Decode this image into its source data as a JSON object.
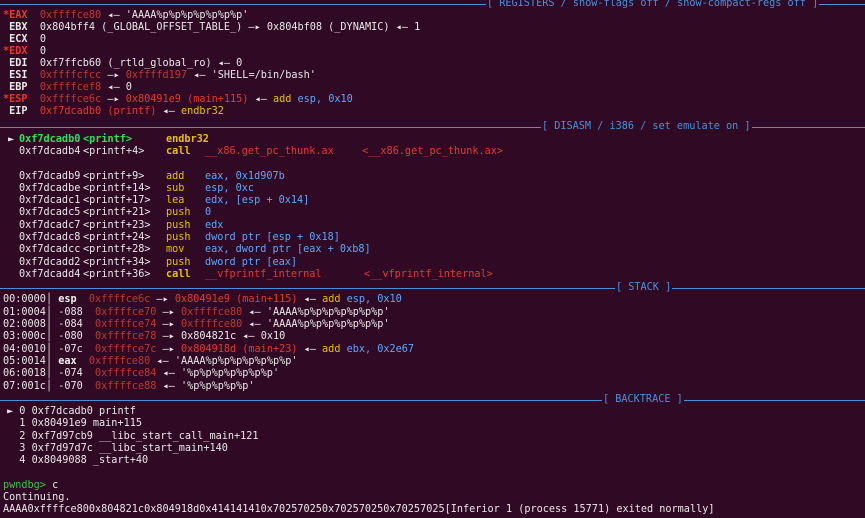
{
  "sections": {
    "registers": "[ REGISTERS / show-flags off / show-compact-regs off ]",
    "disasm": "[ DISASM / i386 / set emulate on ]",
    "stack": "[ STACK ]",
    "backtrace": "[ BACKTRACE ]"
  },
  "registers": {
    "eax": {
      "name": "*EAX",
      "addr": "0xffffce80",
      "arrow": "◂—",
      "str": "'AAAA%p%p%p%p%p%p%p'"
    },
    "ebx": {
      "name": " EBX",
      "addr": "0x804bff4",
      "sym": "(_GLOBAL_OFFSET_TABLE_)",
      "arrow": "—▸",
      "addr2": "0x804bf08",
      "sym2": "(_DYNAMIC)",
      "arrow2": "◂—",
      "val": "1"
    },
    "ecx": {
      "name": " ECX",
      "val": "0"
    },
    "edx": {
      "name": "*EDX",
      "val": "0"
    },
    "edi": {
      "name": " EDI",
      "addr": "0xf7ffcb60",
      "sym": "(_rtld_global_ro)",
      "arrow": "◂—",
      "val": "0"
    },
    "esi": {
      "name": " ESI",
      "addr": "0xffffcfcc",
      "arrow": "—▸",
      "addr2": "0xffffd197",
      "arrow2": "◂—",
      "str": "'SHELL=/bin/bash'"
    },
    "ebp": {
      "name": " EBP",
      "addr": "0xffffcef8",
      "arrow": "◂—",
      "val": "0"
    },
    "esp": {
      "name": "*ESP",
      "addr": "0xffffce6c",
      "arrow": "—▸",
      "addr2": "0x80491e9",
      "sym2": "(main+115)",
      "arrow2": "◂—",
      "ins": "add",
      "ops": "esp, 0x10"
    },
    "eip": {
      "name": " EIP",
      "addr": "0xf7dcadb0",
      "sym": "(printf)",
      "arrow": "◂—",
      "ins": "endbr32"
    }
  },
  "disasm": [
    {
      "cur": "►",
      "addr": "0xf7dcadb0",
      "sym": "<printf>",
      "ins": "endbr32",
      "ops": "",
      "tgt": ""
    },
    {
      "cur": "",
      "addr": "0xf7dcadb4",
      "sym": "<printf+4>",
      "ins": "call",
      "ops": "__x86.get_pc_thunk.ax",
      "tgt": "<__x86.get_pc_thunk.ax>"
    },
    {
      "cur": "",
      "addr": "0xf7dcadb9",
      "sym": "<printf+9>",
      "ins": "add",
      "ops": "eax, 0x1d907b",
      "tgt": ""
    },
    {
      "cur": "",
      "addr": "0xf7dcadbe",
      "sym": "<printf+14>",
      "ins": "sub",
      "ops": "esp, 0xc",
      "tgt": ""
    },
    {
      "cur": "",
      "addr": "0xf7dcadc1",
      "sym": "<printf+17>",
      "ins": "lea",
      "ops": "edx, [esp + 0x14]",
      "tgt": ""
    },
    {
      "cur": "",
      "addr": "0xf7dcadc5",
      "sym": "<printf+21>",
      "ins": "push",
      "ops": "0",
      "tgt": ""
    },
    {
      "cur": "",
      "addr": "0xf7dcadc7",
      "sym": "<printf+23>",
      "ins": "push",
      "ops": "edx",
      "tgt": ""
    },
    {
      "cur": "",
      "addr": "0xf7dcadc8",
      "sym": "<printf+24>",
      "ins": "push",
      "ops": "dword ptr [esp + 0x18]",
      "tgt": ""
    },
    {
      "cur": "",
      "addr": "0xf7dcadcc",
      "sym": "<printf+28>",
      "ins": "mov",
      "ops": "eax, dword ptr [eax + 0xb8]",
      "tgt": ""
    },
    {
      "cur": "",
      "addr": "0xf7dcadd2",
      "sym": "<printf+34>",
      "ins": "push",
      "ops": "dword ptr [eax]",
      "tgt": ""
    },
    {
      "cur": "",
      "addr": "0xf7dcadd4",
      "sym": "<printf+36>",
      "ins": "call",
      "ops": "__vfprintf_internal",
      "tgt": "<__vfprintf_internal>"
    }
  ],
  "stack": [
    {
      "idx": "00:0000",
      "reg": "esp",
      "off": "",
      "addr": "0xffffce6c",
      "a1": "—▸",
      "v1": "0x80491e9",
      "s1": "(main+115)",
      "a2": "◂—",
      "ins": "add",
      "ops": "esp, 0x10"
    },
    {
      "idx": "01:0004",
      "reg": "",
      "off": "-088",
      "addr": "0xffffce70",
      "a1": "—▸",
      "v1": "0xffffce80",
      "s1": "",
      "a2": "◂—",
      "str": "'AAAA%p%p%p%p%p%p%p'"
    },
    {
      "idx": "02:0008",
      "reg": "",
      "off": "-084",
      "addr": "0xffffce74",
      "a1": "—▸",
      "v1": "0xffffce80",
      "s1": "",
      "a2": "◂—",
      "str": "'AAAA%p%p%p%p%p%p%p'"
    },
    {
      "idx": "03:000c",
      "reg": "",
      "off": "-080",
      "addr": "0xffffce78",
      "a1": "—▸",
      "v1": "0x804821c",
      "s1": "",
      "a2": "◂—",
      "val": "0x10"
    },
    {
      "idx": "04:0010",
      "reg": "",
      "off": "-07c",
      "addr": "0xffffce7c",
      "a1": "—▸",
      "v1": "0x804918d",
      "s1": "(main+23)",
      "a2": "◂—",
      "ins": "add",
      "ops": "ebx, 0x2e67"
    },
    {
      "idx": "05:0014",
      "reg": "eax",
      "off": "",
      "addr": "0xffffce80",
      "a2": "◂—",
      "str": "'AAAA%p%p%p%p%p%p%p'"
    },
    {
      "idx": "06:0018",
      "reg": "",
      "off": "-074",
      "addr": "0xffffce84",
      "a2": "◂—",
      "str": "'%p%p%p%p%p%p%p'"
    },
    {
      "idx": "07:001c",
      "reg": "",
      "off": "-070",
      "addr": "0xffffce88",
      "a2": "◂—",
      "str": "'%p%p%p%p%p'"
    }
  ],
  "backtrace": [
    {
      "cur": "►",
      "n": "0",
      "addr": "0xf7dcadb0",
      "fn": "printf"
    },
    {
      "cur": "",
      "n": "1",
      "addr": "0x80491e9",
      "fn": "main+115"
    },
    {
      "cur": "",
      "n": "2",
      "addr": "0xf7d97cb9",
      "fn": "__libc_start_call_main+121"
    },
    {
      "cur": "",
      "n": "3",
      "addr": "0xf7d97d7c",
      "fn": "__libc_start_main+140"
    },
    {
      "cur": "",
      "n": "4",
      "addr": "0x8049088",
      "fn": "_start+40"
    }
  ],
  "console": {
    "prompt": "pwndbg>",
    "command": "c",
    "line1": "Continuing.",
    "line2": "AAAA0xffffce800x804821c0x804918d0x414141410x702570250x702570250x70257025[Inferior 1 (process 15771) exited normally]"
  }
}
